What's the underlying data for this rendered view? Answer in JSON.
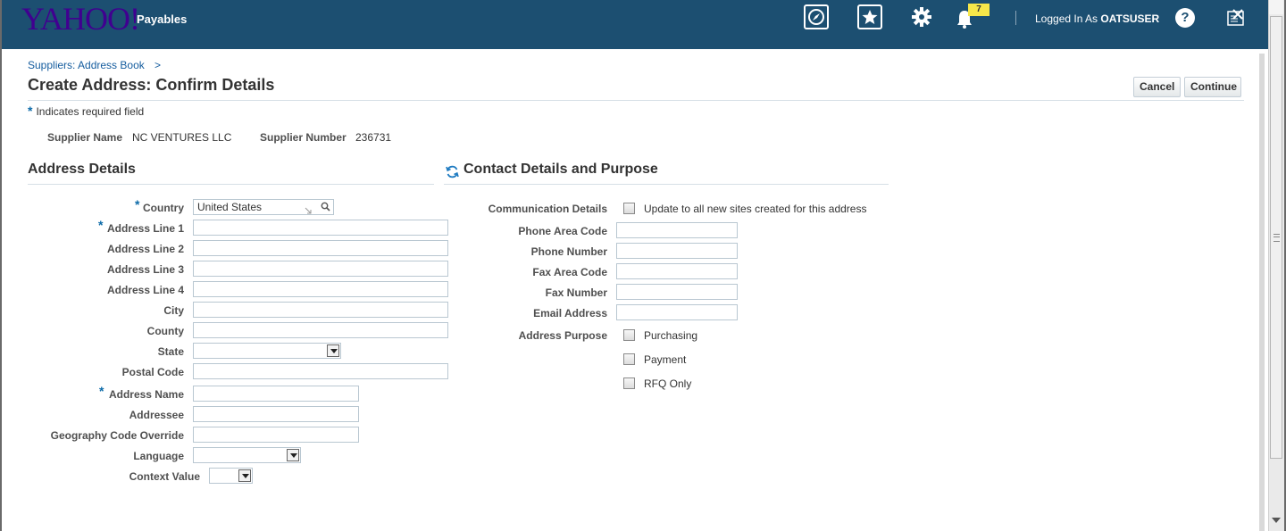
{
  "header": {
    "logo": "YAHOO!",
    "app_name": "Payables",
    "notification_count": "7",
    "logged_in_prefix": "Logged In As",
    "user": "OATSUSER",
    "help": "?"
  },
  "breadcrumb": {
    "label": "Suppliers: Address Book",
    "separator": ">"
  },
  "page": {
    "title": "Create Address: Confirm Details",
    "cancel": "Cancel",
    "continue": "Continue",
    "required_star": "*",
    "required_note": "Indicates required field"
  },
  "supplier": {
    "name_label": "Supplier Name",
    "name": "NC VENTURES LLC",
    "number_label": "Supplier Number",
    "number": "236731"
  },
  "address_details": {
    "heading": "Address Details",
    "country_label": "Country",
    "country_value": "United States",
    "address_line_1_label": "Address Line 1",
    "address_line_2_label": "Address Line 2",
    "address_line_3_label": "Address Line 3",
    "address_line_4_label": "Address Line 4",
    "city_label": "City",
    "county_label": "County",
    "state_label": "State",
    "postal_code_label": "Postal Code",
    "address_name_label": "Address Name",
    "addressee_label": "Addressee",
    "geography_label": "Geography Code Override",
    "language_label": "Language",
    "context_label": "Context Value"
  },
  "contact_details": {
    "heading": "Contact Details and Purpose",
    "communication_label": "Communication Details",
    "update_all_label": "Update to all new sites created for this address",
    "phone_area_label": "Phone Area Code",
    "phone_number_label": "Phone Number",
    "fax_area_label": "Fax Area Code",
    "fax_number_label": "Fax Number",
    "email_label": "Email Address",
    "purpose_label": "Address Purpose",
    "purchasing_label": "Purchasing",
    "payment_label": "Payment",
    "rfq_label": "RFQ Only"
  },
  "icons": {
    "navigator": "compass-icon",
    "favorites": "star-icon",
    "settings": "gear-icon",
    "notifications": "bell-icon",
    "help": "help-icon",
    "window_close": "close-window-icon",
    "refresh": "refresh-icon",
    "search": "search-icon"
  },
  "colors": {
    "header_bg": "#1c4f71",
    "logo": "#400090",
    "link": "#145c9e",
    "required_star": "#0b6aa8",
    "badge": "#f6e74a"
  }
}
